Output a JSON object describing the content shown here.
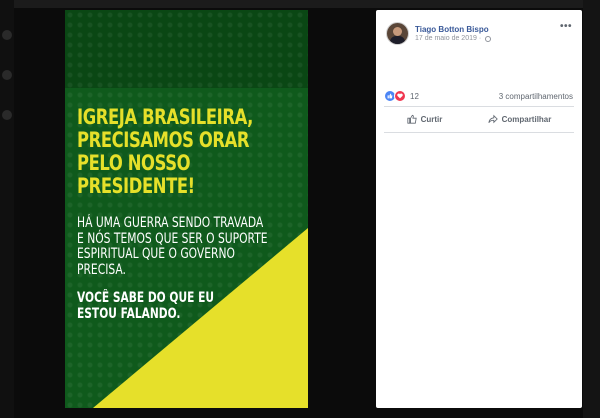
{
  "poster": {
    "headline_lines": [
      "IGREJA BRASILEIRA,",
      "PRECISAMOS ORAR",
      "PELO NOSSO",
      "PRESIDENTE!"
    ],
    "body_lines": [
      "HÁ UMA GUERRA SENDO TRAVADA",
      "E NÓS TEMOS QUE SER O SUPORTE",
      "ESPIRITUAL QUE O GOVERNO",
      "PRECISA."
    ],
    "closing_lines": [
      "VOCÊ SABE DO QUE EU",
      "ESTOU FALANDO."
    ],
    "colors": {
      "green": "#0f5a1c",
      "dark_green": "#0a4714",
      "yellow": "#e6e02a"
    }
  },
  "post": {
    "author": "Tiago Botton Bispo",
    "date": "17 de maio de 2019",
    "separator": "·",
    "privacy_icon": "globe-icon",
    "more_icon": "ellipsis-icon",
    "reaction_count": "12",
    "shares": "3 compartilhamentos",
    "like_label": "Curtir",
    "share_label": "Compartilhar"
  }
}
